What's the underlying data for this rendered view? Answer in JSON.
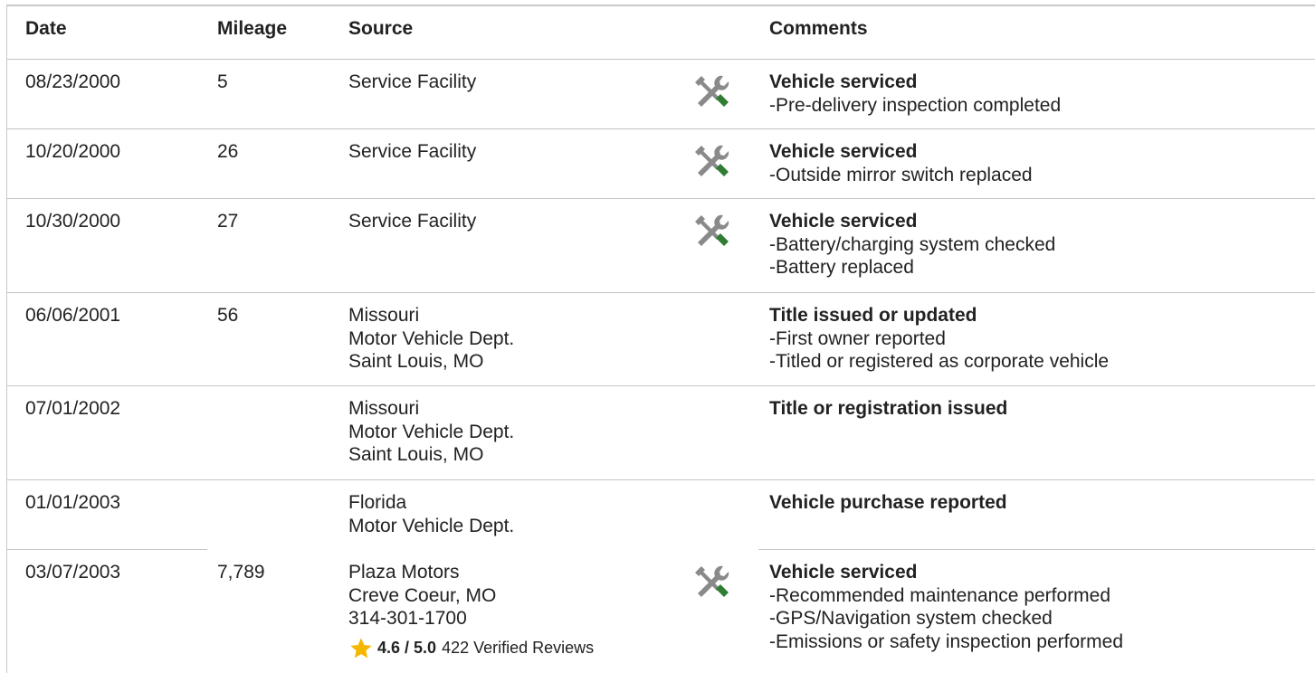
{
  "headers": {
    "date": "Date",
    "mileage": "Mileage",
    "source": "Source",
    "comments": "Comments"
  },
  "rows": [
    {
      "date": "08/23/2000",
      "mileage": "5",
      "source": [
        "Service Facility"
      ],
      "icon": "service-tools-icon",
      "comment_title": "Vehicle serviced",
      "comment_lines": [
        "Pre-delivery inspection completed"
      ]
    },
    {
      "date": "10/20/2000",
      "mileage": "26",
      "source": [
        "Service Facility"
      ],
      "icon": "service-tools-icon",
      "comment_title": "Vehicle serviced",
      "comment_lines": [
        "Outside mirror switch replaced"
      ]
    },
    {
      "date": "10/30/2000",
      "mileage": "27",
      "source": [
        "Service Facility"
      ],
      "icon": "service-tools-icon",
      "comment_title": "Vehicle serviced",
      "comment_lines": [
        "Battery/charging system checked",
        "Battery replaced"
      ]
    },
    {
      "date": "06/06/2001",
      "mileage": "56",
      "source": [
        "Missouri",
        "Motor Vehicle Dept.",
        "Saint Louis, MO"
      ],
      "icon": null,
      "comment_title": "Title issued or updated",
      "comment_lines": [
        "First owner reported",
        "Titled or registered as corporate vehicle"
      ]
    },
    {
      "date": "07/01/2002",
      "mileage": "",
      "source": [
        "Missouri",
        "Motor Vehicle Dept.",
        "Saint Louis, MO"
      ],
      "icon": null,
      "comment_title": "Title or registration issued",
      "comment_lines": []
    },
    {
      "date": "01/01/2003",
      "mileage": "",
      "source": [
        "Florida",
        "Motor Vehicle Dept."
      ],
      "icon": null,
      "comment_title": "Vehicle purchase reported",
      "comment_lines": []
    },
    {
      "date": "03/07/2003",
      "mileage": "7,789",
      "source": [
        "Plaza Motors",
        "Creve Coeur, MO",
        "314-301-1700"
      ],
      "icon": "service-tools-icon",
      "review": {
        "score": "4.6 / 5.0",
        "count": "422 Verified Reviews"
      },
      "comment_title": "Vehicle serviced",
      "comment_lines": [
        "Recommended maintenance performed",
        "GPS/Navigation system checked",
        "Emissions or safety inspection performed"
      ]
    }
  ],
  "colors": {
    "text": "#222222",
    "divider": "#c4c4c4",
    "icon_gray": "#8a8a8a",
    "icon_green": "#2e7d32",
    "star": "#f5b800"
  },
  "icons": {
    "service": "service-tools-icon",
    "star": "star-icon"
  }
}
